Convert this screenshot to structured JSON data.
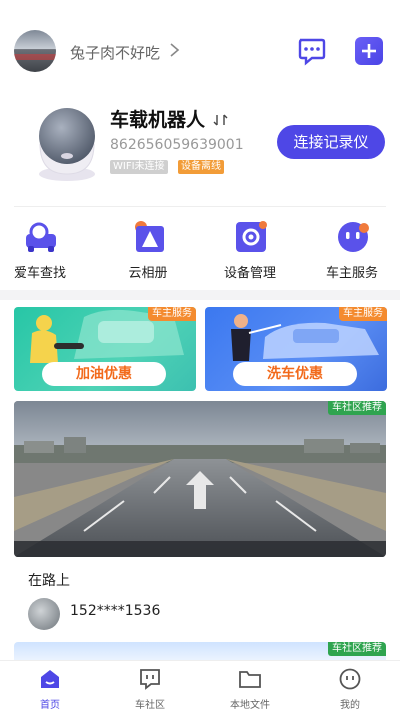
{
  "header": {
    "username": "兔子肉不好吃"
  },
  "device": {
    "name": "车载机器人",
    "id": "862656059639001",
    "wifi_status": "WIFI未连接",
    "device_status": "设备离线",
    "connect_label": "连接记录仪"
  },
  "features": [
    {
      "label": "爱车查找",
      "icon": "car-search-icon"
    },
    {
      "label": "云相册",
      "icon": "cloud-album-icon"
    },
    {
      "label": "设备管理",
      "icon": "device-settings-icon"
    },
    {
      "label": "车主服务",
      "icon": "owner-service-icon"
    }
  ],
  "promos": [
    {
      "tag": "车主服务",
      "label": "加油优惠"
    },
    {
      "tag": "车主服务",
      "label": "洗车优惠"
    }
  ],
  "feed": {
    "tag": "车社区推荐",
    "title": "在路上",
    "user": "152****1536",
    "next_tag": "车社区推荐"
  },
  "tabs": [
    {
      "label": "首页",
      "icon": "home-icon",
      "active": true
    },
    {
      "label": "车社区",
      "icon": "community-icon",
      "active": false
    },
    {
      "label": "本地文件",
      "icon": "folder-icon",
      "active": false
    },
    {
      "label": "我的",
      "icon": "profile-icon",
      "active": false
    }
  ],
  "colors": {
    "accent": "#4e47e6",
    "warning": "#f29c38",
    "promo_tag": "#f48b2f",
    "community_tag": "#2fa44f"
  }
}
